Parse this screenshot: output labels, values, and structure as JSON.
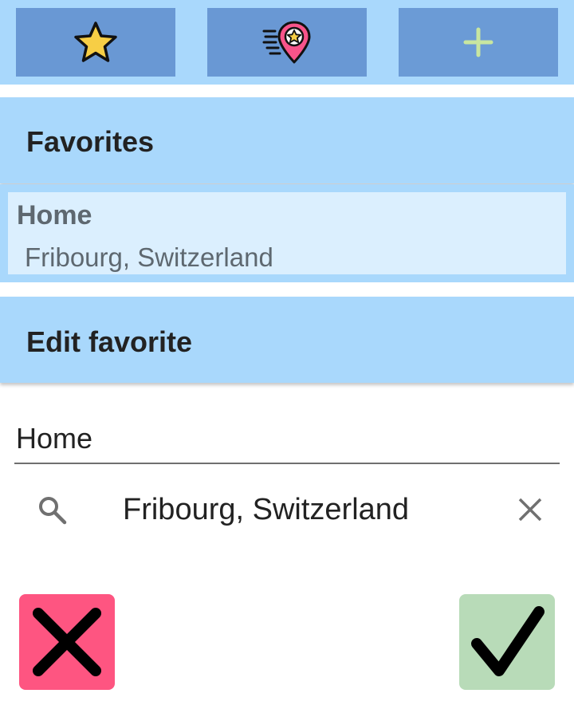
{
  "toolbar": {
    "buttons": [
      {
        "icon": "star-icon"
      },
      {
        "icon": "location-pin-star-icon"
      },
      {
        "icon": "plus-icon"
      }
    ]
  },
  "favorites_section": {
    "title": "Favorites",
    "items": [
      {
        "name": "Home",
        "address": "Fribourg, Switzerland"
      }
    ]
  },
  "edit_section": {
    "title": "Edit favorite",
    "name_value": "Home",
    "location_value": "Fribourg, Switzerland"
  },
  "actions": {
    "cancel_icon": "close-x-icon",
    "confirm_icon": "checkmark-icon"
  },
  "colors": {
    "panel_background": "#a9d8fc",
    "toolbar_button": "#6998d4",
    "selected_item": "#dbeffe",
    "cancel": "#fe5581",
    "confirm": "#b8dbb8",
    "star": "#f7ce45",
    "pin": "#f7548a",
    "plus": "#c8e6a0"
  }
}
